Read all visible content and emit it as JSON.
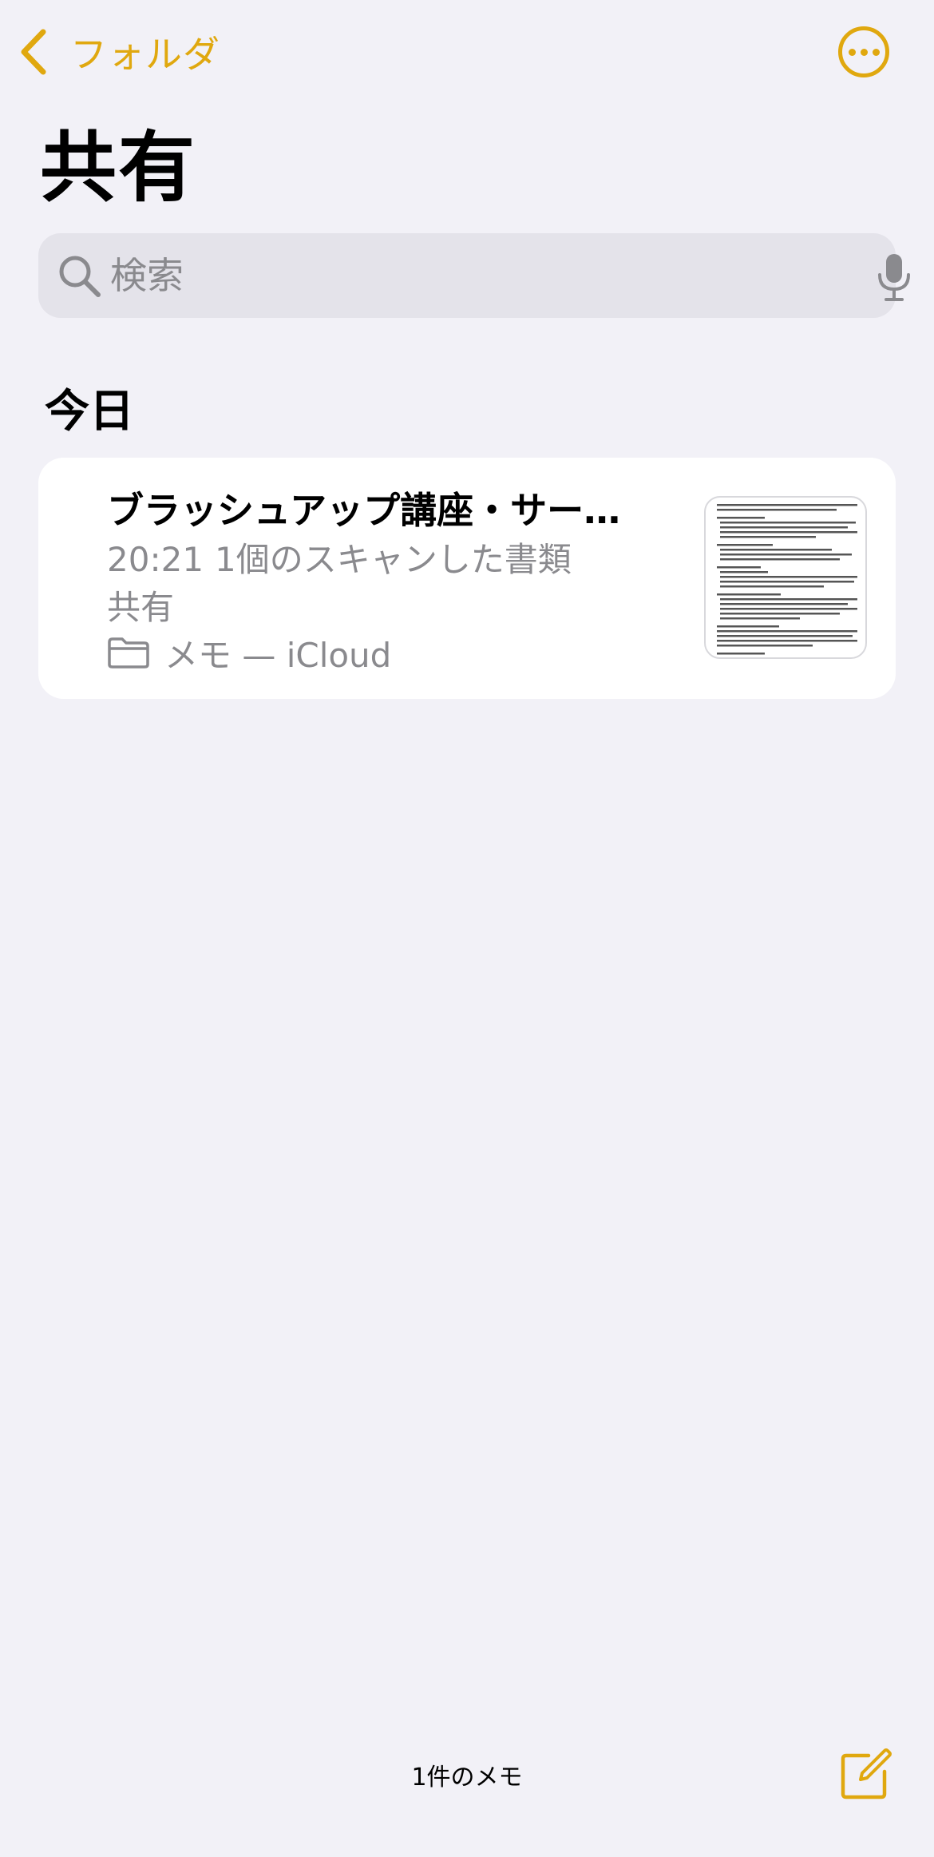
{
  "colors": {
    "accent": "#E0A80F",
    "background": "#F2F1F7",
    "secondary_text": "#8A8A8E"
  },
  "nav": {
    "back_label": "フォルダ",
    "back_icon": "chevron-left-icon",
    "more_icon": "ellipsis-circle-icon"
  },
  "page": {
    "title": "共有"
  },
  "search": {
    "placeholder": "検索",
    "value": "",
    "icon": "search-icon",
    "mic_icon": "microphone-icon"
  },
  "sections": [
    {
      "header": "今日",
      "notes": [
        {
          "title": "ブラッシュアップ講座・サー…",
          "time": "20:21",
          "preview": "1個のスキャンした書類",
          "shared_label": "共有",
          "folder": "メモ — iCloud",
          "folder_icon": "folder-icon",
          "thumbnail": "scanned-document-thumbnail"
        }
      ]
    }
  ],
  "footer": {
    "note_count": "1件のメモ",
    "compose_icon": "compose-icon"
  }
}
